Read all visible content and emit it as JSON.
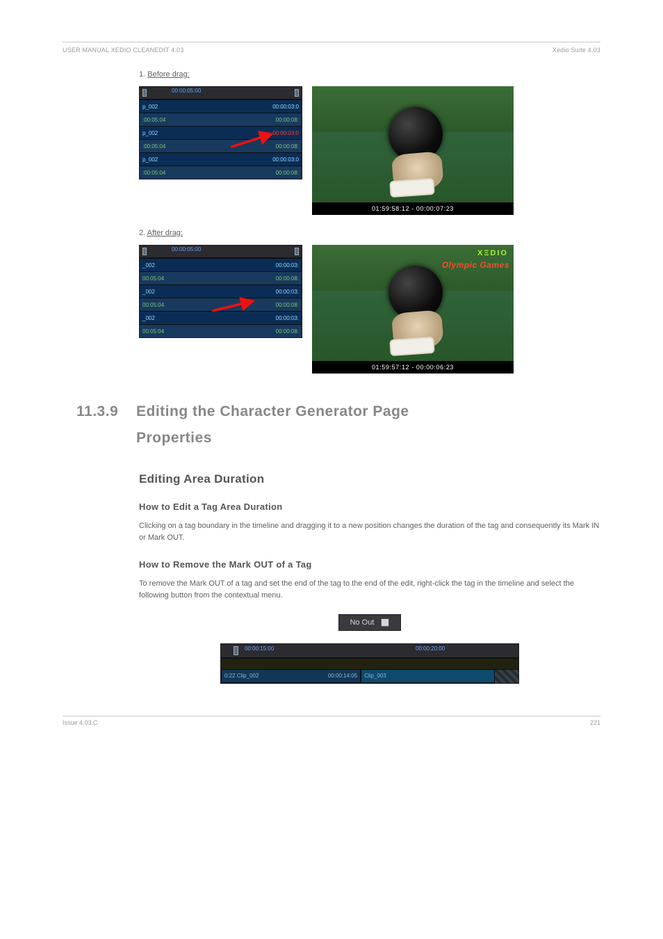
{
  "header": {
    "left": "USER MANUAL XEDIO CLEANEDIT 4.03",
    "right": "Xedio Suite 4.03"
  },
  "line_1a": "1. ",
  "line_1b": "Before drag: ",
  "line_2a": "2. ",
  "line_2b": "After drag:",
  "section": {
    "number": "11.3.9",
    "title_line1": "Editing the Character Generator Page",
    "title_line2": "Properties"
  },
  "sub_heading": "Editing Area Duration",
  "howto1_title": "How to Edit a Tag Area Duration",
  "howto1_body": "Clicking on a tag boundary in the timeline and dragging it to a new position changes the duration of the tag and consequently its Mark IN or Mark OUT.",
  "howto2_title": "How to Remove the Mark OUT of a Tag",
  "howto2_body": "To remove the Mark OUT of a tag and set the end of the tag to the end of the edit, right-click the tag in the timeline and select the following button from the contextual menu.",
  "noout_label": "No Out",
  "ruler_tick_a": "00:00:05:00",
  "ruler_tick_b": "00:00:05:00",
  "tlw_ruler_t1": "00:00:15:00",
  "tlw_ruler_t2": "00:00:20:00",
  "tl_rows_a": [
    {
      "l": "p_002",
      "r": "00:00:03:0"
    },
    {
      "l": ":00:05:04",
      "r": "00:00:08:"
    },
    {
      "l": "p_002",
      "r": "00:00:03:0"
    },
    {
      "l": ":00:05:04",
      "r": "00:00:08:"
    },
    {
      "l": "p_002",
      "r": "00:00:03:0"
    },
    {
      "l": ":00:05:04",
      "r": "00:00:08:"
    }
  ],
  "tl_rows_b": [
    {
      "l": "_002",
      "r": "00:00:03:"
    },
    {
      "l": "00:05:04",
      "r": "00:00:08:"
    },
    {
      "l": "_002",
      "r": "00:00:03:"
    },
    {
      "l": "00:05:04",
      "r": "00:00:08:"
    },
    {
      "l": "_002",
      "r": "00:00:03:"
    },
    {
      "l": "00:05:04",
      "r": "00:00:08:"
    }
  ],
  "vid_a_tc": "01:59:58:12  -  00:00:07:23",
  "vid_b_tc": "01:59:57:12  -  00:00:06:23",
  "vid_logo": "XΞDIO",
  "vid_tag": "Olympic Games",
  "tlw_clip_a_left": "0:22",
  "tlw_clip_a_name": "Clip_002",
  "tlw_clip_a_right": "00:00:14:05",
  "tlw_clip_b_name": "Clip_003",
  "footer": {
    "left": "Issue 4.03.C",
    "right": "221"
  }
}
